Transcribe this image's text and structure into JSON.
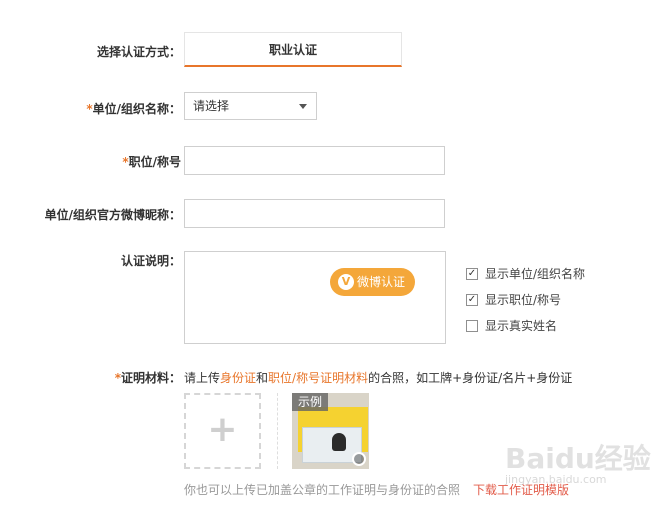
{
  "auth_method": {
    "label": "选择认证方式：",
    "tab": "职业认证"
  },
  "org_name": {
    "required_mark": "*",
    "label": "单位/组织名称：",
    "select_value": "请选择"
  },
  "position": {
    "required_mark": "*",
    "label": "职位/称号",
    "value": ""
  },
  "weibo_nick": {
    "label": "单位/组织官方微博昵称：",
    "value": ""
  },
  "description": {
    "label": "认证说明：",
    "value": "",
    "weibo_button": "微博认证",
    "weibo_badge": "V"
  },
  "display_options": [
    {
      "label": "显示单位/组织名称",
      "checked": true
    },
    {
      "label": "显示职位/称号",
      "checked": true
    },
    {
      "label": "显示真实姓名",
      "checked": false
    }
  ],
  "proof": {
    "required_mark": "*",
    "label": "证明材料：",
    "hint_prefix": "请上传",
    "hint_link1": "身份证",
    "hint_and": "和",
    "hint_link2": "职位/称号证明材料",
    "hint_suffix": "的合照，如工牌+身份证/名片+身份证",
    "upload_symbol": "+",
    "sample_tag": "示例",
    "footnote": "你也可以上传已加盖公章的工作证明与身份证的合照",
    "download_link": "下载工作证明模版"
  },
  "watermark": {
    "brand": "Baidu经验",
    "sub": "jingyan.baidu.com"
  },
  "colors": {
    "accent": "#e8762b",
    "weibo": "#f4a73a",
    "download": "#e25c4a"
  }
}
